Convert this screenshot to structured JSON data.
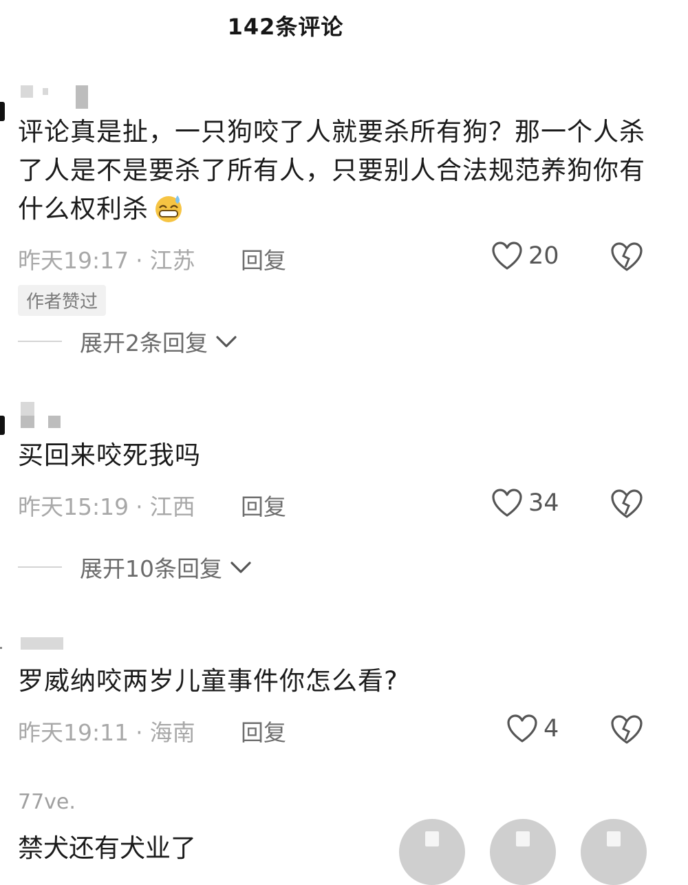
{
  "header": {
    "title": "142条评论"
  },
  "comments": [
    {
      "text": "评论真是扯，一只狗咬了人就要杀所有狗？那一个人杀了人是不是要杀了所有人，只要别人合法规范养狗你有什么权利杀",
      "emoji": "grinning-sweat-emoji",
      "time": "昨天19:17",
      "dot": "·",
      "location": "江苏",
      "reply_label": "回复",
      "likes": "20",
      "author_tag": "作者赞过",
      "expand_label": "展开2条回复"
    },
    {
      "text": "买回来咬死我吗",
      "time": "昨天15:19",
      "dot": "·",
      "location": "江西",
      "reply_label": "回复",
      "likes": "34",
      "expand_label": "展开10条回复"
    },
    {
      "text": "罗威纳咬两岁儿童事件你怎么看?",
      "time": "昨天19:11",
      "dot": "·",
      "location": "海南",
      "reply_label": "回复",
      "likes": "4"
    },
    {
      "username": "77ve.",
      "text": "禁犬还有犬业了"
    }
  ],
  "icons": {
    "like": "heart-outline-icon",
    "dislike": "broken-heart-icon",
    "expand": "chevron-down-icon"
  },
  "colors": {
    "text": "#1b1b1b",
    "meta": "#a8a8a8",
    "icon": "#555555"
  }
}
